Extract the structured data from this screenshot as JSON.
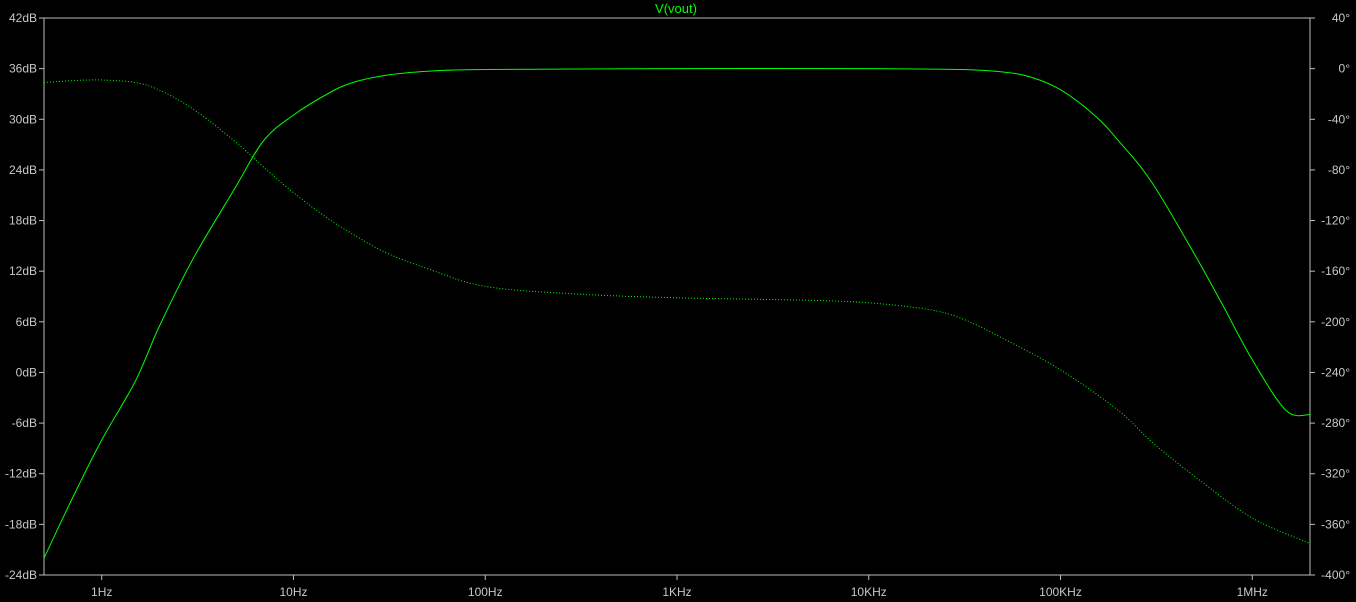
{
  "chart_data": {
    "type": "line",
    "title": "V(vout)",
    "x_scale": "log",
    "x_range_hz": [
      0.5,
      2000000
    ],
    "x_ticks": [
      {
        "value": 1,
        "label": "1Hz"
      },
      {
        "value": 10,
        "label": "10Hz"
      },
      {
        "value": 100,
        "label": "100Hz"
      },
      {
        "value": 1000,
        "label": "1KHz"
      },
      {
        "value": 10000,
        "label": "10KHz"
      },
      {
        "value": 100000,
        "label": "100KHz"
      },
      {
        "value": 1000000,
        "label": "1MHz"
      }
    ],
    "y_left": {
      "range": [
        -24,
        42
      ],
      "ticks": [
        {
          "value": 42,
          "label": "42dB"
        },
        {
          "value": 36,
          "label": "36dB"
        },
        {
          "value": 30,
          "label": "30dB"
        },
        {
          "value": 24,
          "label": "24dB"
        },
        {
          "value": 18,
          "label": "18dB"
        },
        {
          "value": 12,
          "label": "12dB"
        },
        {
          "value": 6,
          "label": "6dB"
        },
        {
          "value": 0,
          "label": "0dB"
        },
        {
          "value": -6,
          "label": "-6dB"
        },
        {
          "value": -12,
          "label": "-12dB"
        },
        {
          "value": -18,
          "label": "-18dB"
        },
        {
          "value": -24,
          "label": "-24dB"
        }
      ]
    },
    "y_right": {
      "range": [
        -400,
        40
      ],
      "ticks": [
        {
          "value": 40,
          "label": "40°"
        },
        {
          "value": 0,
          "label": "0°"
        },
        {
          "value": -40,
          "label": "-40°"
        },
        {
          "value": -80,
          "label": "-80°"
        },
        {
          "value": -120,
          "label": "-120°"
        },
        {
          "value": -160,
          "label": "-160°"
        },
        {
          "value": -200,
          "label": "-200°"
        },
        {
          "value": -240,
          "label": "-240°"
        },
        {
          "value": -280,
          "label": "-280°"
        },
        {
          "value": -320,
          "label": "-320°"
        },
        {
          "value": -360,
          "label": "-360°"
        },
        {
          "value": -400,
          "label": "-400°"
        }
      ]
    },
    "grid": false,
    "series": [
      {
        "quantity": "magnitude",
        "axis": "left",
        "style": "solid",
        "color": "#00ff00",
        "points": [
          [
            0.5,
            -22
          ],
          [
            0.7,
            -15
          ],
          [
            1,
            -8
          ],
          [
            1.5,
            -1
          ],
          [
            2,
            5.5
          ],
          [
            3,
            13.5
          ],
          [
            5,
            22
          ],
          [
            7,
            27.5
          ],
          [
            10,
            30.5
          ],
          [
            15,
            33
          ],
          [
            20,
            34.3
          ],
          [
            30,
            35.2
          ],
          [
            50,
            35.7
          ],
          [
            100,
            35.9
          ],
          [
            1000,
            36
          ],
          [
            10000,
            36
          ],
          [
            30000,
            35.9
          ],
          [
            50000,
            35.6
          ],
          [
            70000,
            35
          ],
          [
            100000,
            33.5
          ],
          [
            150000,
            30.5
          ],
          [
            200000,
            27.5
          ],
          [
            300000,
            22.5
          ],
          [
            500000,
            14
          ],
          [
            700000,
            8
          ],
          [
            1000000,
            1.5
          ],
          [
            1500000,
            -4.5
          ],
          [
            2000000,
            -5
          ]
        ]
      },
      {
        "quantity": "phase",
        "axis": "right",
        "style": "dotted",
        "color": "#00ff00",
        "points": [
          [
            0.5,
            -11
          ],
          [
            0.7,
            -9.5
          ],
          [
            1,
            -9
          ],
          [
            1.5,
            -11
          ],
          [
            2,
            -17
          ],
          [
            3,
            -32
          ],
          [
            5,
            -58
          ],
          [
            7,
            -78
          ],
          [
            10,
            -98
          ],
          [
            15,
            -118
          ],
          [
            20,
            -130
          ],
          [
            30,
            -145
          ],
          [
            50,
            -158
          ],
          [
            100,
            -172
          ],
          [
            300,
            -178
          ],
          [
            1000,
            -181
          ],
          [
            5000,
            -183
          ],
          [
            10000,
            -185
          ],
          [
            20000,
            -190
          ],
          [
            30000,
            -197
          ],
          [
            50000,
            -213
          ],
          [
            100000,
            -238
          ],
          [
            200000,
            -270
          ],
          [
            300000,
            -295
          ],
          [
            500000,
            -322
          ],
          [
            1000000,
            -355
          ],
          [
            2000000,
            -375
          ]
        ]
      }
    ]
  }
}
